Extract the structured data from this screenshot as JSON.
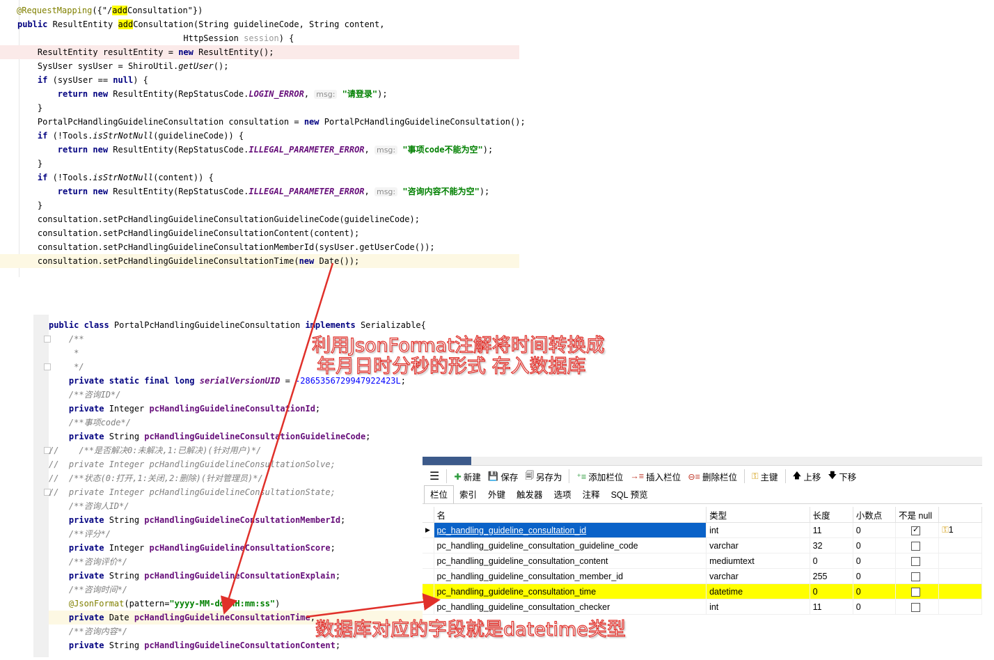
{
  "code_top": {
    "lines": [
      [
        {
          "t": "@RequestMapping",
          "c": "ann"
        },
        {
          "t": "({\"/"
        },
        {
          "t": "add",
          "c": "sel"
        },
        {
          "t": "Consultation\"})"
        }
      ],
      [
        {
          "t": "public ",
          "c": "kw"
        },
        {
          "t": "ResultEntity "
        },
        {
          "t": "add",
          "c": "sel"
        },
        {
          "t": "Consultation(String guidelineCode, String content,"
        }
      ],
      [
        {
          "t": "                                 HttpSession "
        },
        {
          "t": "session",
          "c": "grey"
        },
        {
          "t": ") {"
        }
      ],
      [
        {
          "t": "    ResultEntity resultEntity = "
        },
        {
          "t": "new ",
          "c": "kw"
        },
        {
          "t": "ResultEntity();"
        }
      ],
      [
        {
          "t": "    SysUser sysUser = ShiroUtil."
        },
        {
          "t": "getUser",
          "c": "ital"
        },
        {
          "t": "();"
        }
      ],
      [
        {
          "t": "    "
        },
        {
          "t": "if ",
          "c": "kw"
        },
        {
          "t": "(sysUser == "
        },
        {
          "t": "null",
          "c": "kw"
        },
        {
          "t": ") {"
        }
      ],
      [
        {
          "t": "        "
        },
        {
          "t": "return new ",
          "c": "kw"
        },
        {
          "t": "ResultEntity(RepStatusCode."
        },
        {
          "t": "LOGIN_ERROR",
          "c": "const"
        },
        {
          "t": ", "
        },
        {
          "t": "msg:",
          "c": "hint"
        },
        {
          "t": " "
        },
        {
          "t": "\"请登录\"",
          "c": "str"
        },
        {
          "t": ");"
        }
      ],
      [
        {
          "t": "    }"
        }
      ],
      [
        {
          "t": "    PortalPcHandlingGuidelineConsultation consultation = "
        },
        {
          "t": "new ",
          "c": "kw"
        },
        {
          "t": "PortalPcHandlingGuidelineConsultation();"
        }
      ],
      [
        {
          "t": "    "
        },
        {
          "t": "if ",
          "c": "kw"
        },
        {
          "t": "(!Tools."
        },
        {
          "t": "isStrNotNull",
          "c": "ital"
        },
        {
          "t": "(guidelineCode)) {"
        }
      ],
      [
        {
          "t": "        "
        },
        {
          "t": "return new ",
          "c": "kw"
        },
        {
          "t": "ResultEntity(RepStatusCode."
        },
        {
          "t": "ILLEGAL_PARAMETER_ERROR",
          "c": "const"
        },
        {
          "t": ", "
        },
        {
          "t": "msg:",
          "c": "hint"
        },
        {
          "t": " "
        },
        {
          "t": "\"事项code不能为空\"",
          "c": "str"
        },
        {
          "t": ");"
        }
      ],
      [
        {
          "t": "    }"
        }
      ],
      [
        {
          "t": "    "
        },
        {
          "t": "if ",
          "c": "kw"
        },
        {
          "t": "(!Tools."
        },
        {
          "t": "isStrNotNull",
          "c": "ital"
        },
        {
          "t": "(content)) {"
        }
      ],
      [
        {
          "t": "        "
        },
        {
          "t": "return new ",
          "c": "kw"
        },
        {
          "t": "ResultEntity(RepStatusCode."
        },
        {
          "t": "ILLEGAL_PARAMETER_ERROR",
          "c": "const"
        },
        {
          "t": ", "
        },
        {
          "t": "msg:",
          "c": "hint"
        },
        {
          "t": " "
        },
        {
          "t": "\"咨询内容不能为空\"",
          "c": "str"
        },
        {
          "t": ");"
        }
      ],
      [
        {
          "t": "    }"
        }
      ],
      [
        {
          "t": "    consultation.setPcHandlingGuidelineConsultationGuidelineCode(guidelineCode);"
        }
      ],
      [
        {
          "t": "    consultation.setPcHandlingGuidelineConsultationContent(content);"
        }
      ],
      [
        {
          "t": "    consultation.setPcHandlingGuidelineConsultationMemberId(sysUser.getUserCode());"
        }
      ],
      [
        {
          "t": "    consultation.setPcHandlingGuidelineConsultationTime("
        },
        {
          "t": "new ",
          "c": "kw"
        },
        {
          "t": "Date());"
        }
      ]
    ]
  },
  "code_bottom": {
    "lines": [
      [
        {
          "t": "public class ",
          "c": "kw"
        },
        {
          "t": "PortalPcHandlingGuidelineConsultation "
        },
        {
          "t": "implements ",
          "c": "kw"
        },
        {
          "t": "Serializable{"
        }
      ],
      [
        {
          "t": "    /**",
          "c": "cmt"
        }
      ],
      [
        {
          "t": "     *",
          "c": "cmt"
        }
      ],
      [
        {
          "t": "     */",
          "c": "cmt"
        }
      ],
      [
        {
          "t": "    "
        },
        {
          "t": "private static final long ",
          "c": "kw"
        },
        {
          "t": "serialVersionUID",
          "c": "const"
        },
        {
          "t": " = "
        },
        {
          "t": "-2865356729947922423L",
          "c": "num"
        },
        {
          "t": ";"
        }
      ],
      [
        {
          "t": "    /**咨询ID*/",
          "c": "cmt"
        }
      ],
      [
        {
          "t": "    "
        },
        {
          "t": "private ",
          "c": "kw"
        },
        {
          "t": "Integer "
        },
        {
          "t": "pcHandlingGuidelineConsultationId",
          "c": "fld"
        },
        {
          "t": ";"
        }
      ],
      [
        {
          "t": "    /**事项code*/",
          "c": "cmt"
        }
      ],
      [
        {
          "t": "    "
        },
        {
          "t": "private ",
          "c": "kw"
        },
        {
          "t": "String "
        },
        {
          "t": "pcHandlingGuidelineConsultationGuidelineCode",
          "c": "fld"
        },
        {
          "t": ";"
        }
      ],
      [
        {
          "t": "//    /**是否解决0:未解决,1:已解决)(针对用户)*/",
          "c": "cmt"
        }
      ],
      [
        {
          "t": "//  private Integer pcHandlingGuidelineConsultationSolve;",
          "c": "cmt"
        }
      ],
      [
        {
          "t": "//  /**状态(0:打开,1:关闭,2:删除)(针对管理员)*/",
          "c": "cmt"
        }
      ],
      [
        {
          "t": "//  private Integer pcHandlingGuidelineConsultationState;",
          "c": "cmt"
        }
      ],
      [
        {
          "t": "    /**咨询人ID*/",
          "c": "cmt"
        }
      ],
      [
        {
          "t": "    "
        },
        {
          "t": "private ",
          "c": "kw"
        },
        {
          "t": "String "
        },
        {
          "t": "pcHandlingGuidelineConsultationMemberId",
          "c": "fld"
        },
        {
          "t": ";"
        }
      ],
      [
        {
          "t": "    /**评分*/",
          "c": "cmt"
        }
      ],
      [
        {
          "t": "    "
        },
        {
          "t": "private ",
          "c": "kw"
        },
        {
          "t": "Integer "
        },
        {
          "t": "pcHandlingGuidelineConsultationScore",
          "c": "fld"
        },
        {
          "t": ";"
        }
      ],
      [
        {
          "t": "    /**咨询评价*/",
          "c": "cmt"
        }
      ],
      [
        {
          "t": "    "
        },
        {
          "t": "private ",
          "c": "kw"
        },
        {
          "t": "String "
        },
        {
          "t": "pcHandlingGuidelineConsultationExplain",
          "c": "fld"
        },
        {
          "t": ";"
        }
      ],
      [
        {
          "t": "    /**咨询时间*/",
          "c": "cmt"
        }
      ],
      [
        {
          "t": "    "
        },
        {
          "t": "@JsonFormat",
          "c": "ann"
        },
        {
          "t": "(pattern="
        },
        {
          "t": "\"yyyy-MM-dd HH:mm:ss\"",
          "c": "str"
        },
        {
          "t": ")"
        }
      ],
      [
        {
          "t": "    "
        },
        {
          "t": "private ",
          "c": "kw"
        },
        {
          "t": "Date "
        },
        {
          "t": "pcHandlingGuidelineConsultationTime",
          "c": "fld"
        },
        {
          "t": ";"
        }
      ],
      [
        {
          "t": "    /**咨询内容*/",
          "c": "cmt"
        }
      ],
      [
        {
          "t": "    "
        },
        {
          "t": "private ",
          "c": "kw"
        },
        {
          "t": "String "
        },
        {
          "t": "pcHandlingGuidelineConsultationContent",
          "c": "fld"
        },
        {
          "t": ";"
        }
      ]
    ]
  },
  "db_panel": {
    "toolbar": {
      "new_label": "新建",
      "save_label": "保存",
      "save_as_label": "另存为",
      "add_field_label": "添加栏位",
      "insert_field_label": "插入栏位",
      "delete_field_label": "删除栏位",
      "primary_key_label": "主键",
      "move_up_label": "上移",
      "move_down_label": "下移"
    },
    "tabs": [
      "栏位",
      "索引",
      "外键",
      "触发器",
      "选项",
      "注释",
      "SQL 预览"
    ],
    "columns": [
      "名",
      "类型",
      "长度",
      "小数点",
      "不是 null"
    ],
    "rows": [
      {
        "name": "pc_handling_guideline_consultation_id",
        "type": "int",
        "length": "11",
        "decimals": "0",
        "not_null": true,
        "key": "1"
      },
      {
        "name": "pc_handling_guideline_consultation_guideline_code",
        "type": "varchar",
        "length": "32",
        "decimals": "0",
        "not_null": false,
        "key": ""
      },
      {
        "name": "pc_handling_guideline_consultation_content",
        "type": "mediumtext",
        "length": "0",
        "decimals": "0",
        "not_null": false,
        "key": ""
      },
      {
        "name": "pc_handling_guideline_consultation_member_id",
        "type": "varchar",
        "length": "255",
        "decimals": "0",
        "not_null": false,
        "key": ""
      },
      {
        "name": "pc_handling_guideline_consultation_time",
        "type": "datetime",
        "length": "0",
        "decimals": "0",
        "not_null": false,
        "key": ""
      },
      {
        "name": "pc_handling_guideline_consultation_checker",
        "type": "int",
        "length": "11",
        "decimals": "0",
        "not_null": false,
        "key": ""
      }
    ]
  },
  "callouts": {
    "json_format_line1": "利用JsonFormat注解将时间转换成",
    "json_format_line2": "年月日时分秒的形式 存入数据库",
    "datetime_note": "数据库对应的字段就是datetime类型"
  },
  "colors": {
    "arrow": "#e0302a",
    "selected_row": "#0a62c8",
    "highlight_row": "#ffff00"
  }
}
